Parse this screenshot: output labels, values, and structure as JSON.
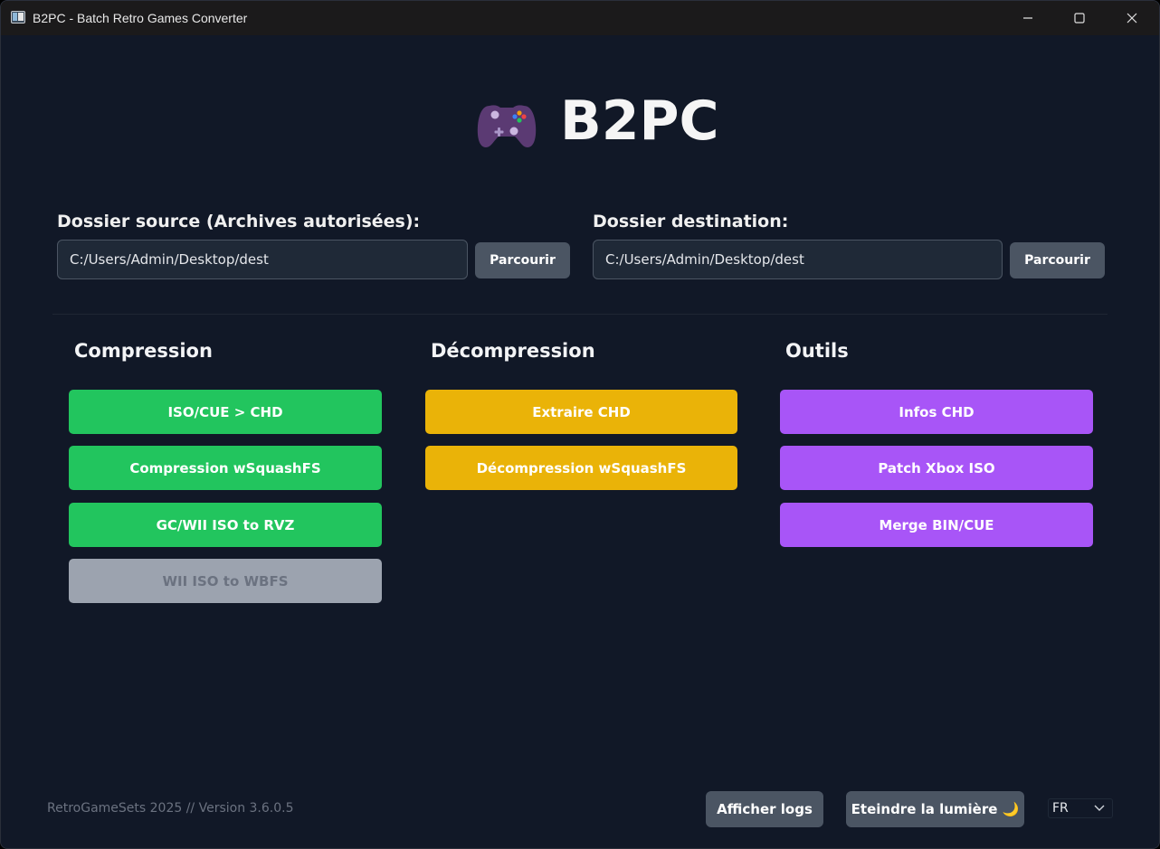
{
  "window": {
    "title": "B2PC - Batch Retro Games Converter",
    "icon": "app-window-icon",
    "controls": [
      "minimize-icon",
      "maximize-icon",
      "close-icon"
    ]
  },
  "header": {
    "logo_icon": "gamepad-icon",
    "title": "B2PC"
  },
  "source": {
    "label": "Dossier source (Archives autorisées):",
    "value": "C:/Users/Admin/Desktop/dest",
    "browse_label": "Parcourir"
  },
  "destination": {
    "label": "Dossier destination:",
    "value": "C:/Users/Admin/Desktop/dest",
    "browse_label": "Parcourir"
  },
  "sections": {
    "compression": {
      "title": "Compression",
      "color": "#22c55e",
      "buttons": [
        "ISO/CUE > CHD",
        "Compression wSquashFS",
        "GC/WII ISO to RVZ",
        "WII ISO to WBFS"
      ],
      "disabled": [
        false,
        false,
        false,
        true
      ]
    },
    "decompression": {
      "title": "Décompression",
      "color": "#eab308",
      "buttons": [
        "Extraire CHD",
        "Décompression wSquashFS"
      ]
    },
    "tools": {
      "title": "Outils",
      "color": "#a855f7",
      "buttons": [
        "Infos CHD",
        "Patch Xbox ISO",
        "Merge BIN/CUE"
      ]
    }
  },
  "footer": {
    "version": "RetroGameSets 2025 // Version 3.6.0.5",
    "logs_label": "Afficher logs",
    "theme_label": "Eteindre la lumière 🌙",
    "language": "FR"
  }
}
